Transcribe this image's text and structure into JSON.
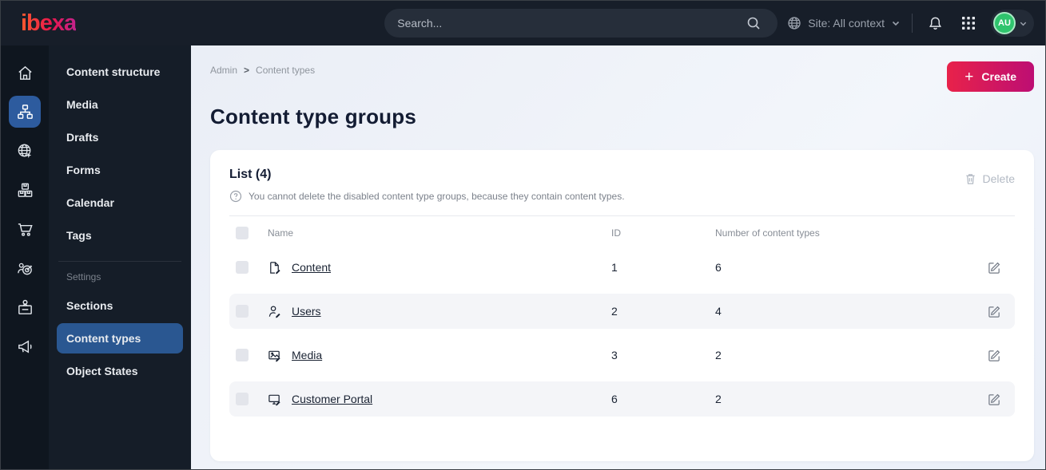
{
  "topbar": {
    "logo": "ibexa",
    "search_placeholder": "Search...",
    "site_context": "Site: All context",
    "avatar_initials": "AU",
    "rail_icons": [
      "home-icon",
      "content-tree-icon",
      "site-globe-icon",
      "products-boxes-icon",
      "cart-icon",
      "audience-target-icon",
      "badge-briefcase-icon",
      "megaphone-icon"
    ]
  },
  "menu": {
    "items": [
      "Content structure",
      "Media",
      "Drafts",
      "Forms",
      "Calendar",
      "Tags"
    ],
    "settings_header": "Settings",
    "settings_items": [
      "Sections",
      "Content types",
      "Object States"
    ],
    "active_item": "Content types"
  },
  "breadcrumb": {
    "items": [
      "Admin",
      "Content types"
    ],
    "separator": ">"
  },
  "page": {
    "title": "Content type groups"
  },
  "toolbar": {
    "create_label": "Create"
  },
  "list": {
    "title": "List (4)",
    "hint": "You cannot delete the disabled content type groups, because they contain content types.",
    "delete_label": "Delete",
    "table": {
      "columns": [
        "Name",
        "ID",
        "Number of content types"
      ],
      "rows": [
        {
          "icon": "file-edit-icon",
          "name": "Content",
          "id": "1",
          "count": "6"
        },
        {
          "icon": "user-edit-icon",
          "name": "Users",
          "id": "2",
          "count": "4"
        },
        {
          "icon": "image-edit-icon",
          "name": "Media",
          "id": "3",
          "count": "2"
        },
        {
          "icon": "screen-edit-icon",
          "name": "Customer Portal",
          "id": "6",
          "count": "2"
        }
      ]
    }
  },
  "colors": {
    "topbar_bg": "#171e29",
    "rail_bg": "#0f161f",
    "panel_bg": "#151d28",
    "active_blue": "#2a5791",
    "create_gradient": [
      "#e8224a",
      "#bd0e73"
    ],
    "avatar_green": "#2fc46d",
    "row_alt_bg": "#f4f5f8"
  }
}
